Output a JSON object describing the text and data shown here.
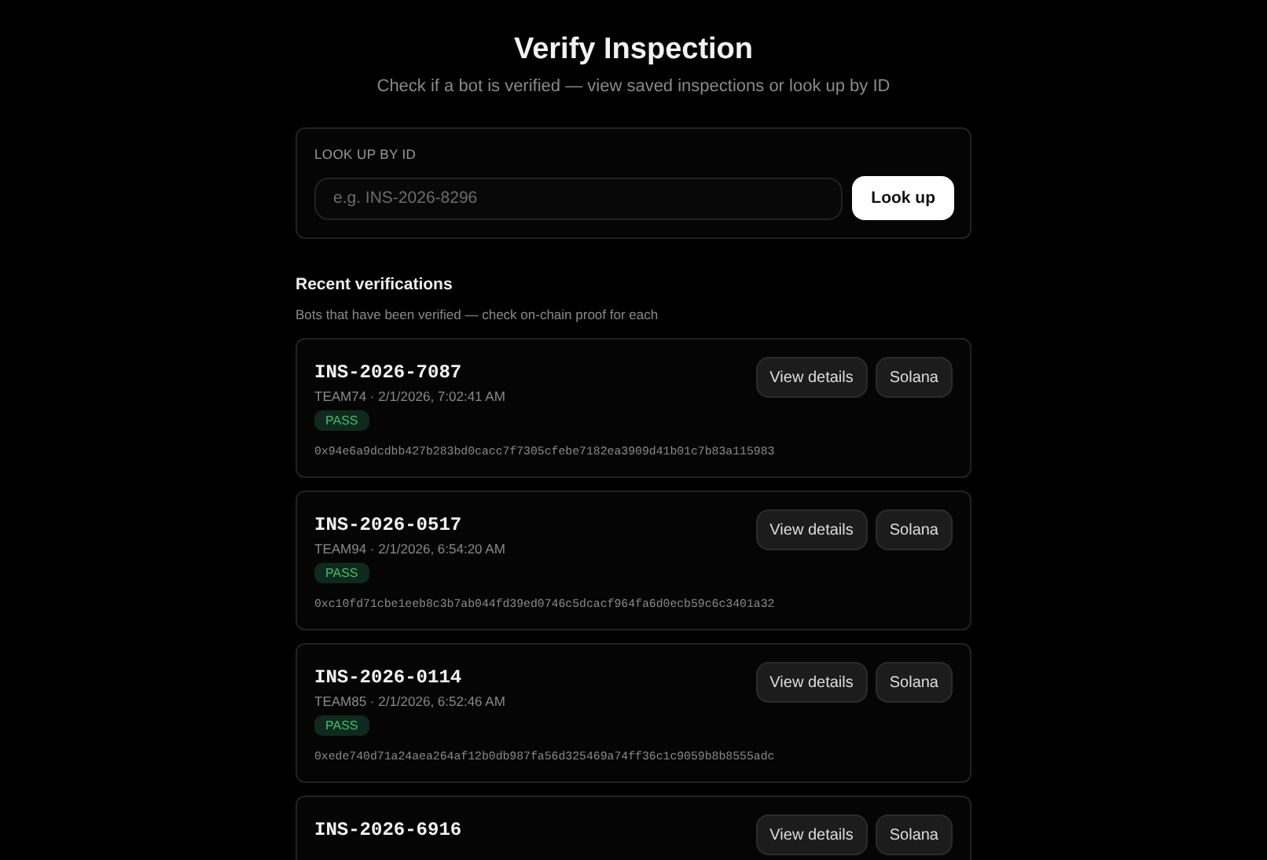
{
  "header": {
    "title": "Verify Inspection",
    "subtitle": "Check if a bot is verified — view saved inspections or look up by ID"
  },
  "lookup": {
    "label": "LOOK UP BY ID",
    "placeholder": "e.g. INS-2026-8296",
    "button": "Look up"
  },
  "recent": {
    "title": "Recent verifications",
    "subtitle": "Bots that have been verified — check on-chain proof for each",
    "items": [
      {
        "id": "INS-2026-7087",
        "meta": "TEAM74 · 2/1/2026, 7:02:41 AM",
        "status": {
          "kind": "pass",
          "label": "PASS"
        },
        "hash": "0x94e6a9dcdbb427b283bd0cacc7f7305cfebe7182ea3909d41b01c7b83a115983",
        "actions": [
          "View details",
          "Solana"
        ]
      },
      {
        "id": "INS-2026-0517",
        "meta": "TEAM94 · 2/1/2026, 6:54:20 AM",
        "status": {
          "kind": "pass",
          "label": "PASS"
        },
        "hash": "0xc10fd71cbe1eeb8c3b7ab044fd39ed0746c5dcacf964fa6d0ecb59c6c3401a32",
        "actions": [
          "View details",
          "Solana"
        ]
      },
      {
        "id": "INS-2026-0114",
        "meta": "TEAM85 · 2/1/2026, 6:52:46 AM",
        "status": {
          "kind": "pass",
          "label": "PASS"
        },
        "hash": "0xede740d71a24aea264af12b0db987fa56d325469a74ff36c1c9059b8b8555adc",
        "actions": [
          "View details",
          "Solana"
        ]
      },
      {
        "id": "INS-2026-6916",
        "actions": [
          "View details",
          "Solana"
        ]
      }
    ]
  }
}
